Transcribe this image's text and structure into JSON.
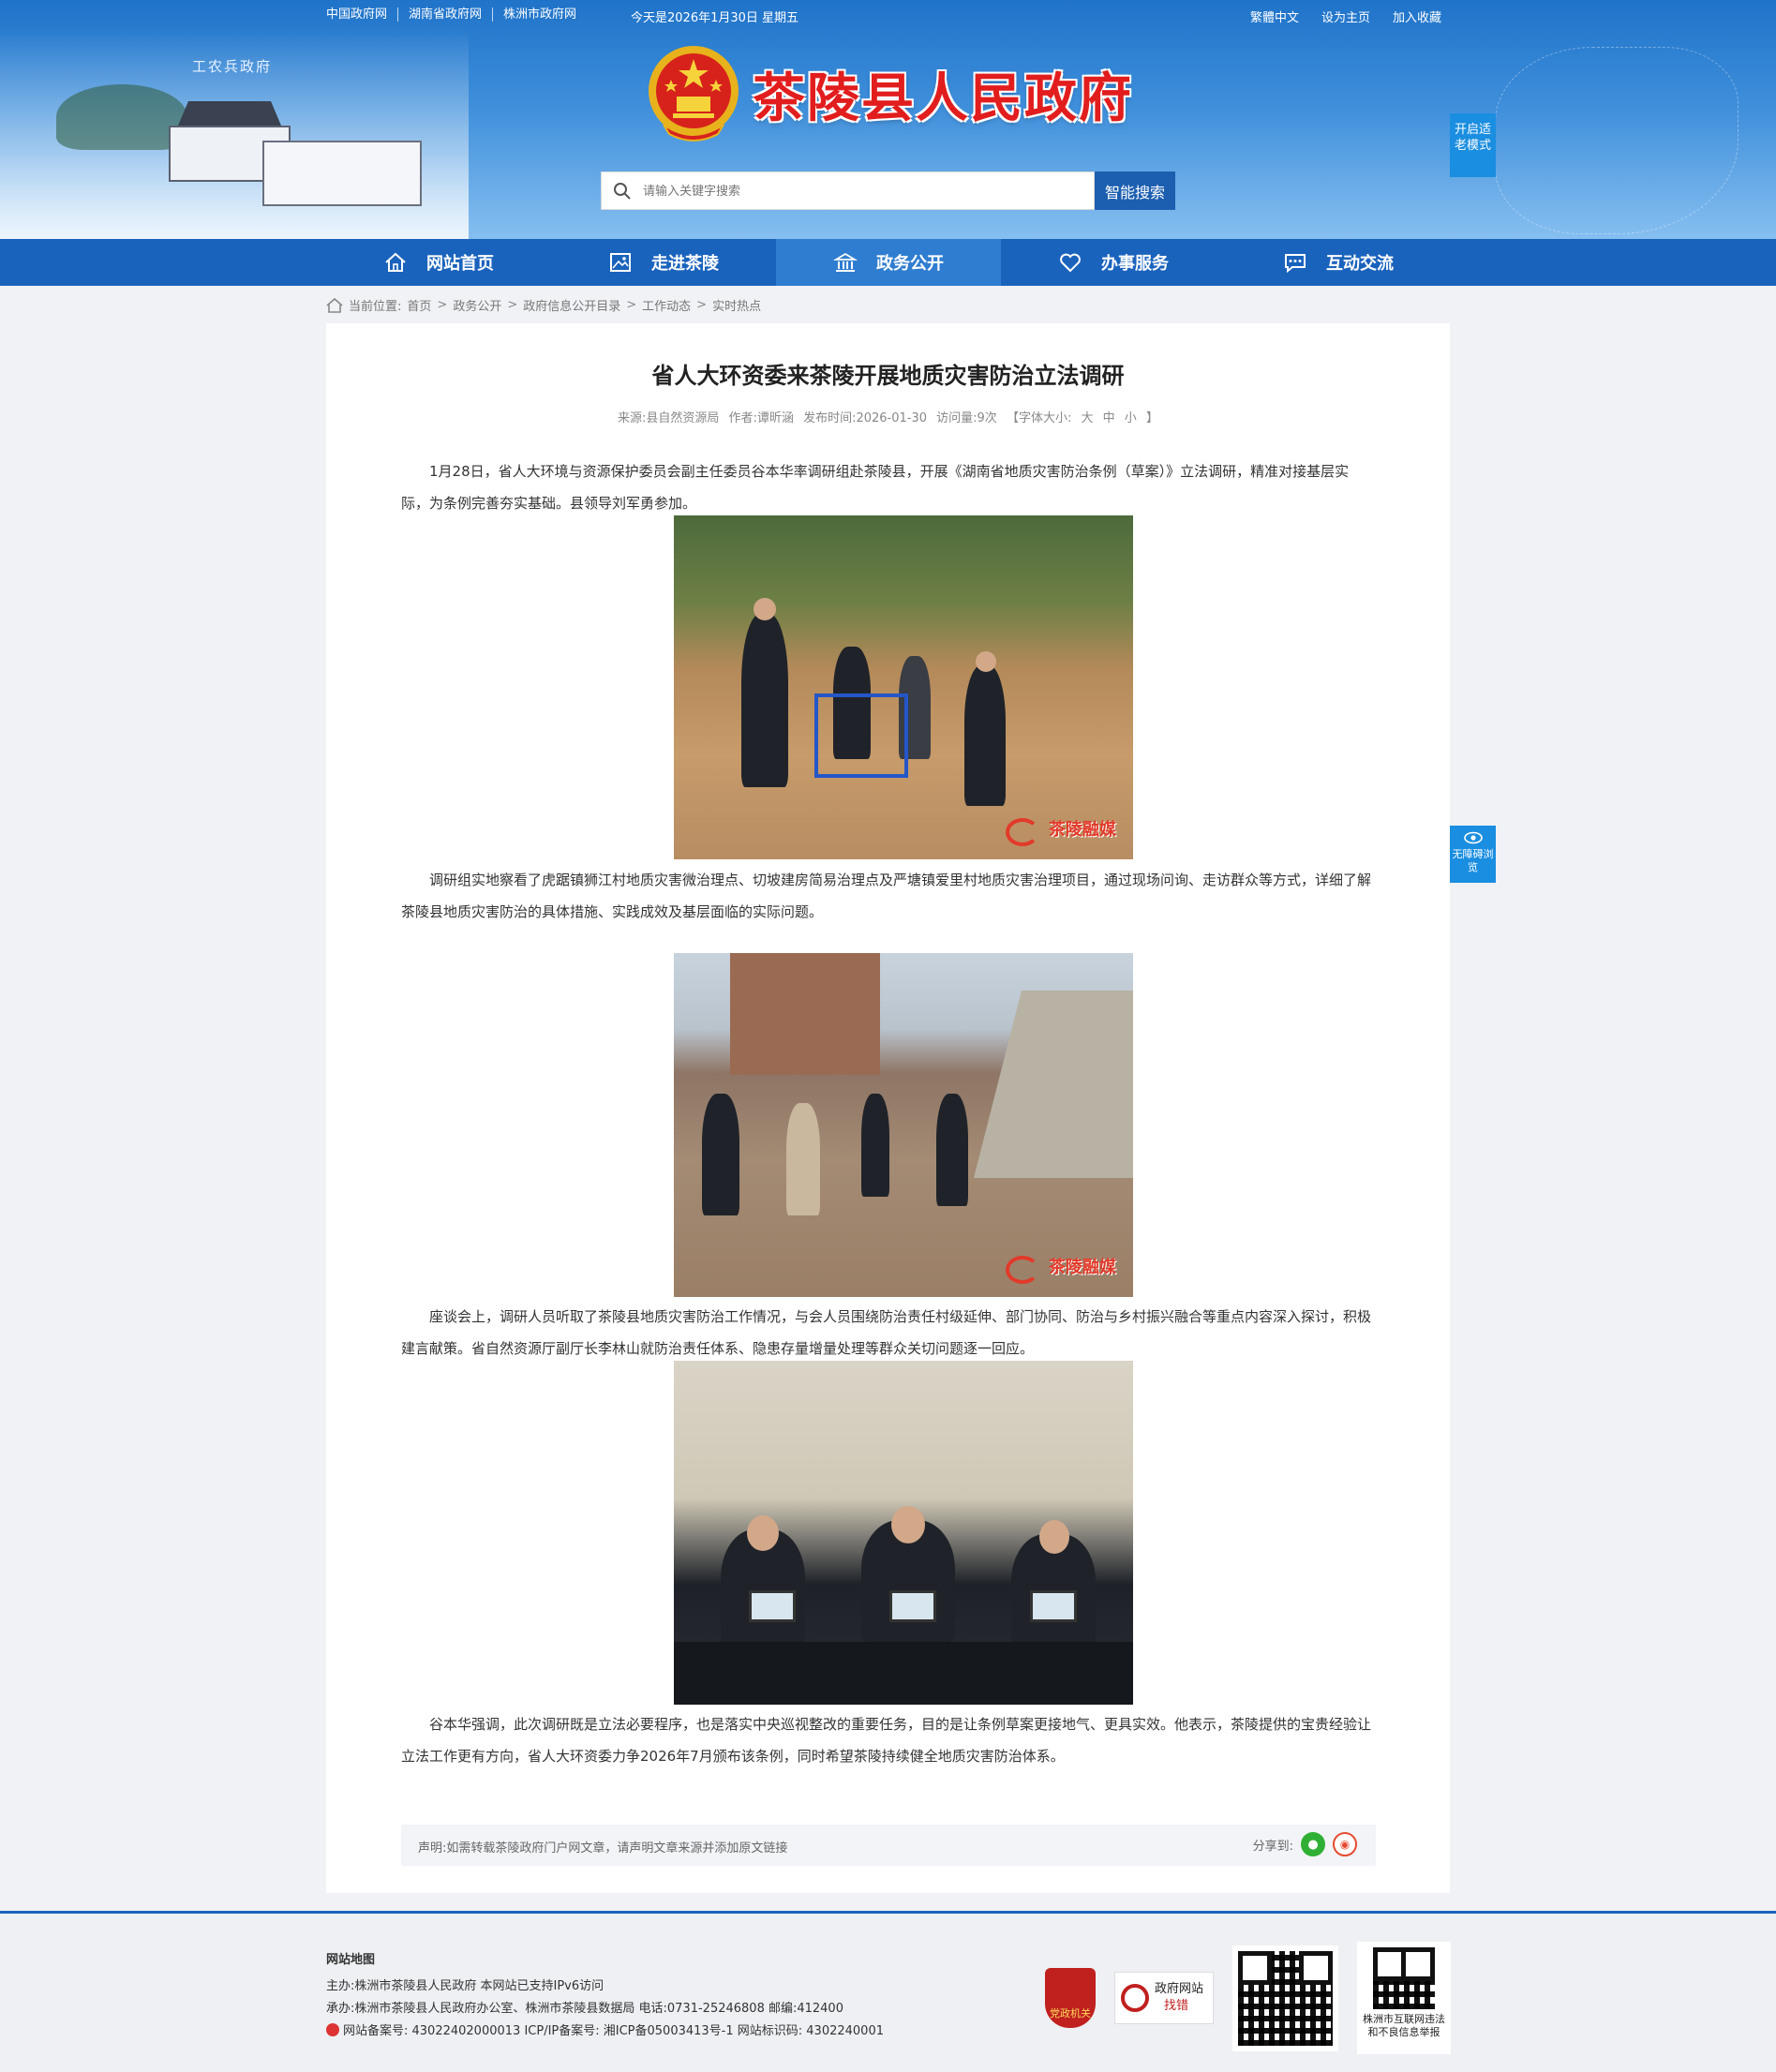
{
  "topbar": {
    "links": [
      "中国政府网",
      "湖南省政府网",
      "株洲市政府网"
    ],
    "date": "今天是2026年1月30日 星期五",
    "right": [
      "繁體中文",
      "设为主页",
      "加入收藏"
    ]
  },
  "header": {
    "banner_caption": "工农兵政府",
    "site_title": "茶陵县人民政府",
    "search_placeholder": "请输入关键字搜索",
    "search_button": "智能搜索",
    "elder_mode": "开启适老模式",
    "accessibility": "无障碍浏览"
  },
  "nav": {
    "items": [
      {
        "label": "网站首页",
        "icon": "home-icon"
      },
      {
        "label": "走进茶陵",
        "icon": "picture-icon"
      },
      {
        "label": "政务公开",
        "icon": "building-icon"
      },
      {
        "label": "办事服务",
        "icon": "heart-icon"
      },
      {
        "label": "互动交流",
        "icon": "chat-icon"
      }
    ],
    "active": "政务公开"
  },
  "breadcrumb": {
    "prefix": "当前位置:",
    "items": [
      "首页",
      "政务公开",
      "政府信息公开目录",
      "工作动态",
      "实时热点"
    ]
  },
  "article": {
    "title": "省人大环资委来茶陵开展地质灾害防治立法调研",
    "meta": {
      "source": "来源:县自然资源局",
      "author": "作者:谭昕涵",
      "publish": "发布时间:2026-01-30",
      "visits": "访问量:9次",
      "font_label": "【字体大小:",
      "font_big": "大",
      "font_mid": "中",
      "font_small": "小",
      "font_close": "】"
    },
    "paragraphs": [
      "1月28日，省人大环境与资源保护委员会副主任委员谷本华率调研组赴茶陵县，开展《湖南省地质灾害防治条例（草案）》立法调研，精准对接基层实际，为条例完善夯实基础。县领导刘军勇参加。",
      "调研组实地察看了虎踞镇狮江村地质灾害微治理点、切坡建房简易治理点及严塘镇爱里村地质灾害治理项目，通过现场问询、走访群众等方式，详细了解茶陵县地质灾害防治的具体措施、实践成效及基层面临的实际问题。",
      "座谈会上，调研人员听取了茶陵县地质灾害防治工作情况，与会人员围绕防治责任村级延伸、部门协同、防治与乡村振兴融合等重点内容深入探讨，积极建言献策。省自然资源厅副厅长李林山就防治责任体系、隐患存量增量处理等群众关切问题逐一回应。",
      "谷本华强调，此次调研既是立法必要程序，也是落实中央巡视整改的重要任务，目的是让条例草案更接地气、更具实效。他表示，茶陵提供的宝贵经验让立法工作更有方向，省人大环资委力争2026年7月颁布该条例，同时希望茶陵持续健全地质灾害防治体系。"
    ],
    "watermark": "茶陵融媒",
    "declaration": "声明:如需转载茶陵政府门户网文章，请声明文章来源并添加原文链接",
    "share_label": "分享到:"
  },
  "footer": {
    "sitemap": "网站地图",
    "host": "主办:株洲市茶陵县人民政府 本网站已支持IPv6访问",
    "organizer": "承办:株洲市茶陵县人民政府办公室、株洲市茶陵县数据局 电话:0731-25246808 邮编:412400",
    "record": "网站备案号: 43022402000013 ICP/IP备案号: 湘ICP备05003413号-1 网站标识码: 4302240001",
    "dang_label": "党政机关",
    "jiucuo_line1": "政府网站",
    "jiucuo_line2": "找错",
    "report_label": "株洲市互联网违法和不良信息举报"
  },
  "colors": {
    "header_blue": "#1f73c9",
    "nav_blue": "#1a63bd",
    "title_red": "#e21d1d",
    "side_button": "#1a8ee0"
  }
}
